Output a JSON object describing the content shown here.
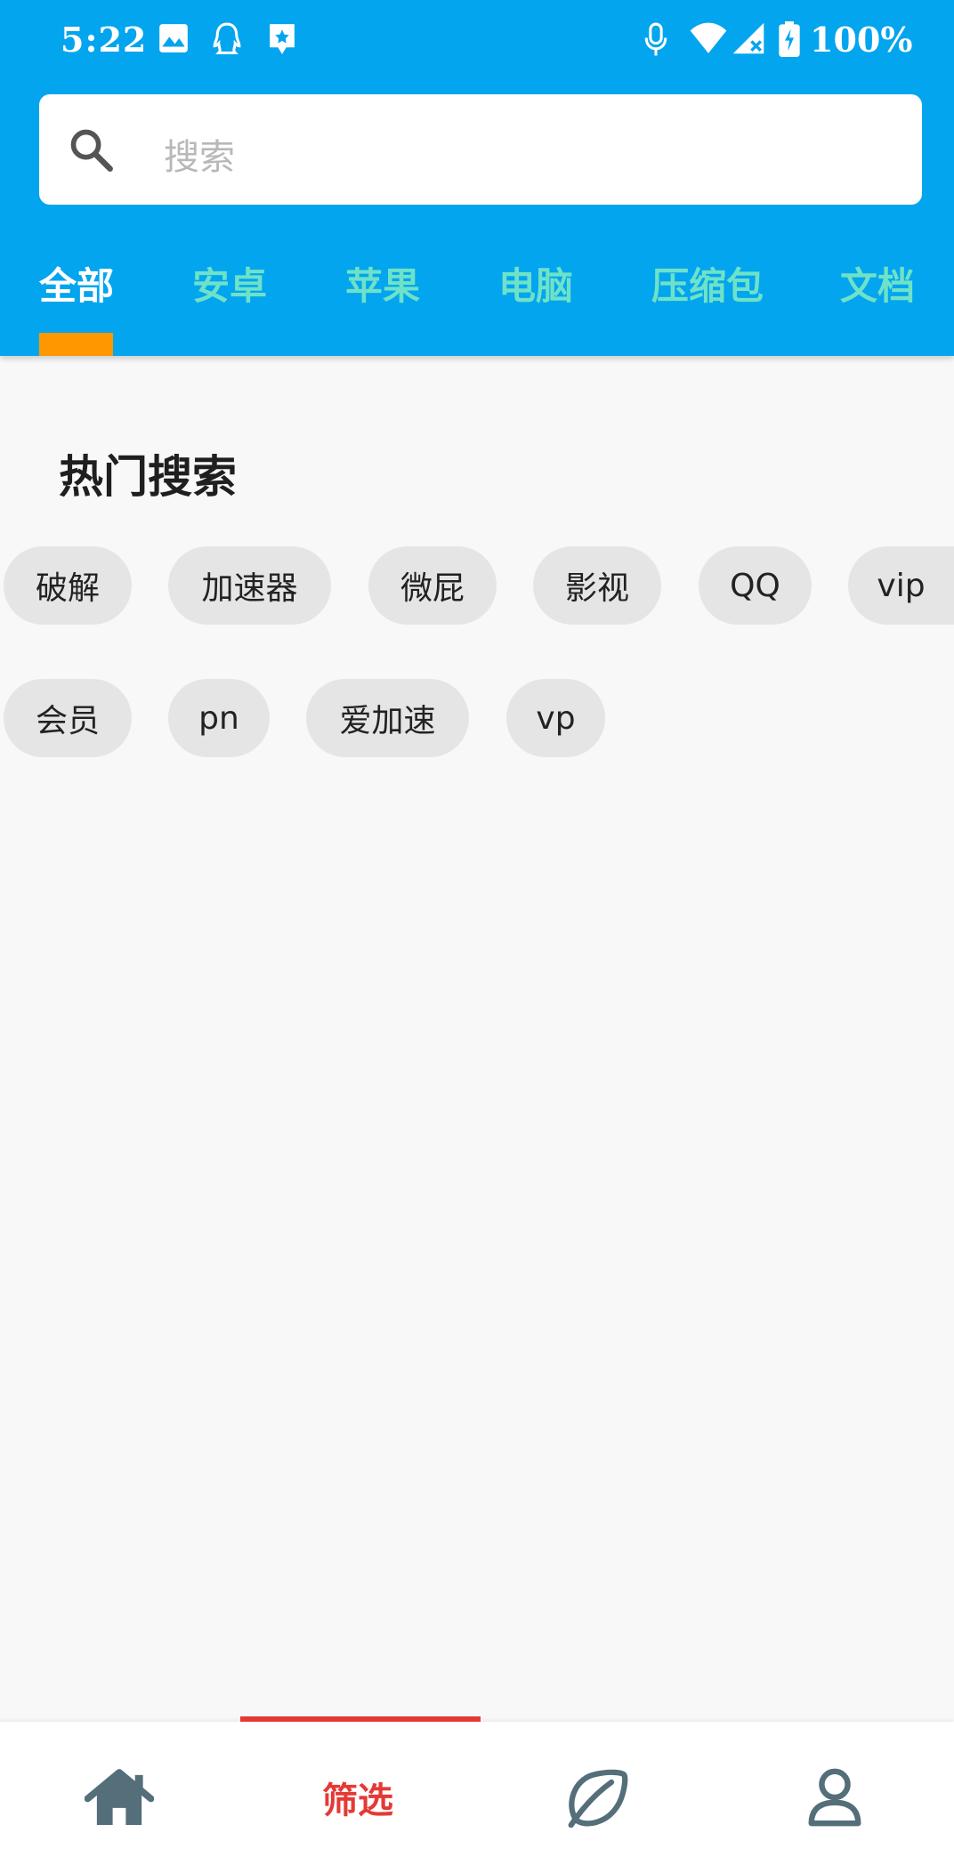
{
  "status_bar": {
    "time": "5:22",
    "battery": "100%",
    "icons": [
      "image-icon",
      "qq-icon",
      "app-notification-icon",
      "mic-icon",
      "wifi-icon",
      "signal-icon",
      "battery-charging-icon"
    ]
  },
  "search": {
    "placeholder": "搜索",
    "icon": "search-icon"
  },
  "tabs": [
    {
      "label": "全部",
      "active": true
    },
    {
      "label": "安卓",
      "active": false
    },
    {
      "label": "苹果",
      "active": false
    },
    {
      "label": "电脑",
      "active": false
    },
    {
      "label": "压缩包",
      "active": false
    },
    {
      "label": "文档",
      "active": false
    }
  ],
  "hot_search": {
    "title": "热门搜索",
    "chips": [
      "破解",
      "加速器",
      "微屁",
      "影视",
      "QQ",
      "vip",
      "会员",
      "pn",
      "爱加速",
      "vp"
    ]
  },
  "bottom_nav": {
    "items": [
      {
        "icon": "home-icon",
        "active": false
      },
      {
        "label": "筛选",
        "active": true
      },
      {
        "icon": "leaf-icon",
        "active": false
      },
      {
        "icon": "profile-icon",
        "active": false
      }
    ]
  },
  "colors": {
    "header": "#03a5ee",
    "tab_inactive": "#6ee2c8",
    "tab_indicator": "#ff9800",
    "nav_active": "#e53935",
    "nav_icon": "#546e7a"
  }
}
